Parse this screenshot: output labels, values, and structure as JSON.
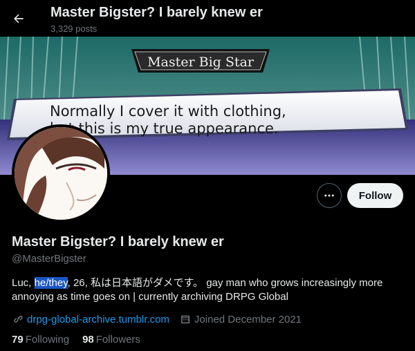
{
  "header": {
    "title": "Master Bigster? I barely knew er",
    "post_count": "3,329 posts"
  },
  "banner": {
    "nameplate": "Master Big Star",
    "dialog_line1": "Normally I cover it with clothing,",
    "dialog_line2": "but this is my true appearance."
  },
  "actions": {
    "follow_label": "Follow"
  },
  "profile": {
    "display_name": "Master Bigster? I barely knew er",
    "handle": "@MasterBigster",
    "bio_before": "Luc, ",
    "bio_highlight": "he/they",
    "bio_after": ", 26, 私は日本語がダメです。 gay man who grows increasingly more annoying as time goes on | currently archiving DRPG Global",
    "website": "drpg-global-archive.tumblr.com",
    "joined": "Joined December 2021",
    "following_count": "79",
    "following_label": "Following",
    "followers_count": "98",
    "followers_label": "Followers"
  },
  "colors": {
    "background": "#000000",
    "link": "#1d9bf0",
    "secondary_text": "#71767b",
    "highlight": "#1a56c4"
  },
  "icons": [
    "back-arrow-icon",
    "more-dots-icon",
    "link-icon",
    "calendar-icon"
  ]
}
